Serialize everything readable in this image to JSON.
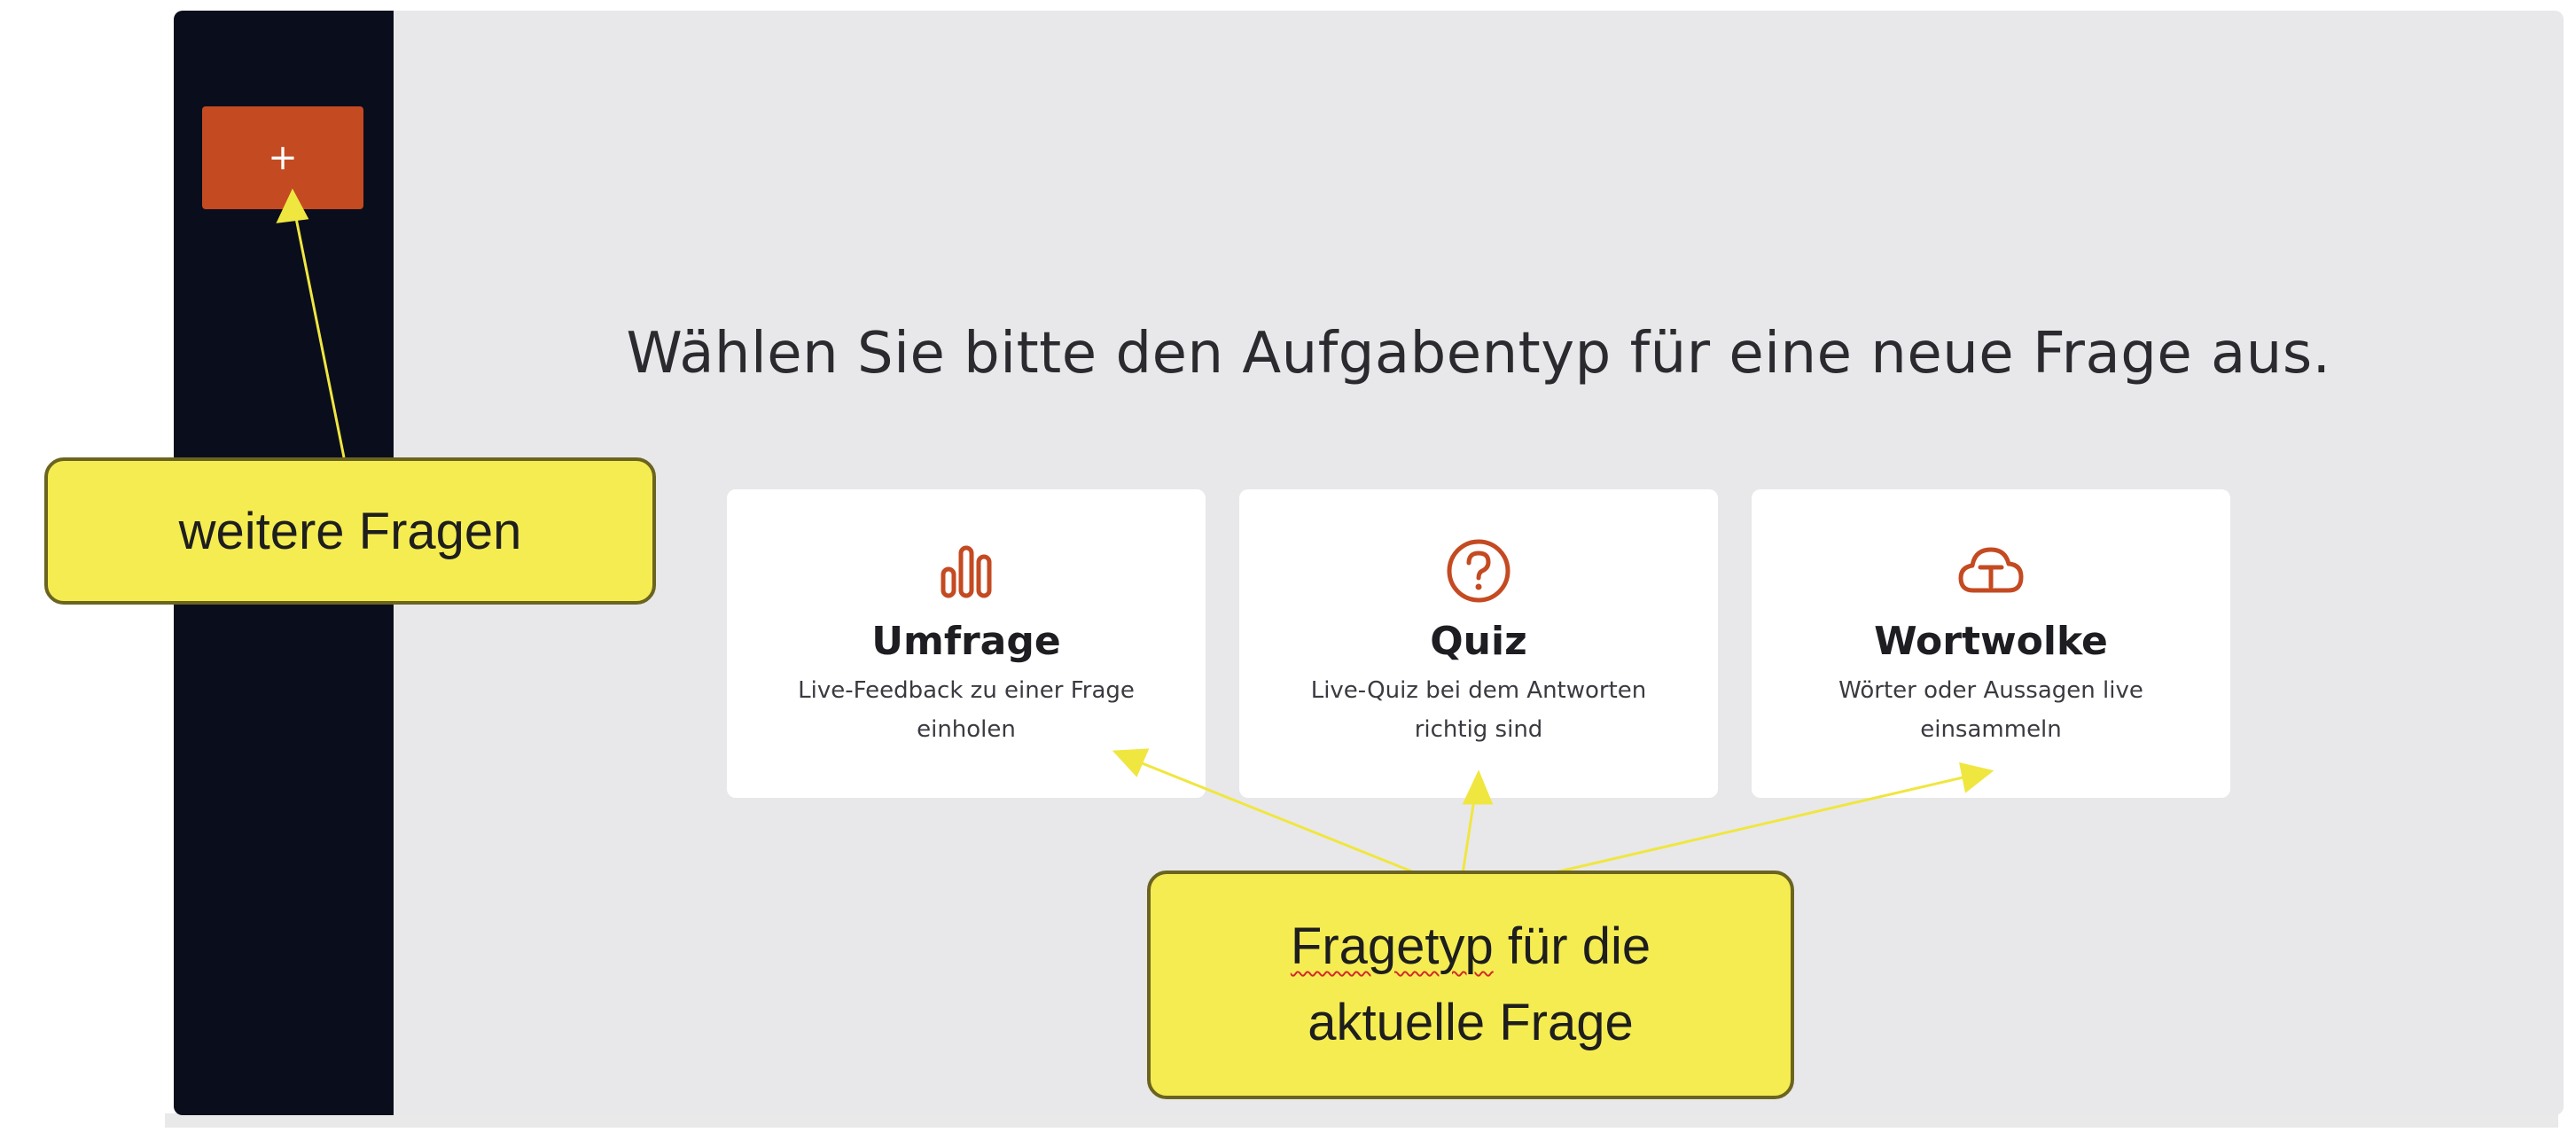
{
  "sidebar": {
    "add_button_label": "+"
  },
  "main": {
    "heading": "Wählen Sie bitte den Aufgabentyp für eine neue Frage aus.",
    "cards": [
      {
        "title": "Umfrage",
        "description": "Live-Feedback zu einer Frage einholen",
        "icon": "bar-chart-icon"
      },
      {
        "title": "Quiz",
        "description": "Live-Quiz bei dem Antworten richtig sind",
        "icon": "question-circle-icon"
      },
      {
        "title": "Wortwolke",
        "description": "Wörter oder Aussagen live einsammeln",
        "icon": "cloud-text-icon"
      }
    ]
  },
  "annotations": {
    "left_callout": "weitere Fragen",
    "bottom_callout_word1": "Fragetyp",
    "bottom_callout_rest_line1": " für die",
    "bottom_callout_line2": "aktuelle Frage"
  },
  "colors": {
    "accent": "#c44a22",
    "sidebar": "#0a0e1c",
    "background": "#e8e8ea",
    "callout": "#f5ec52"
  }
}
